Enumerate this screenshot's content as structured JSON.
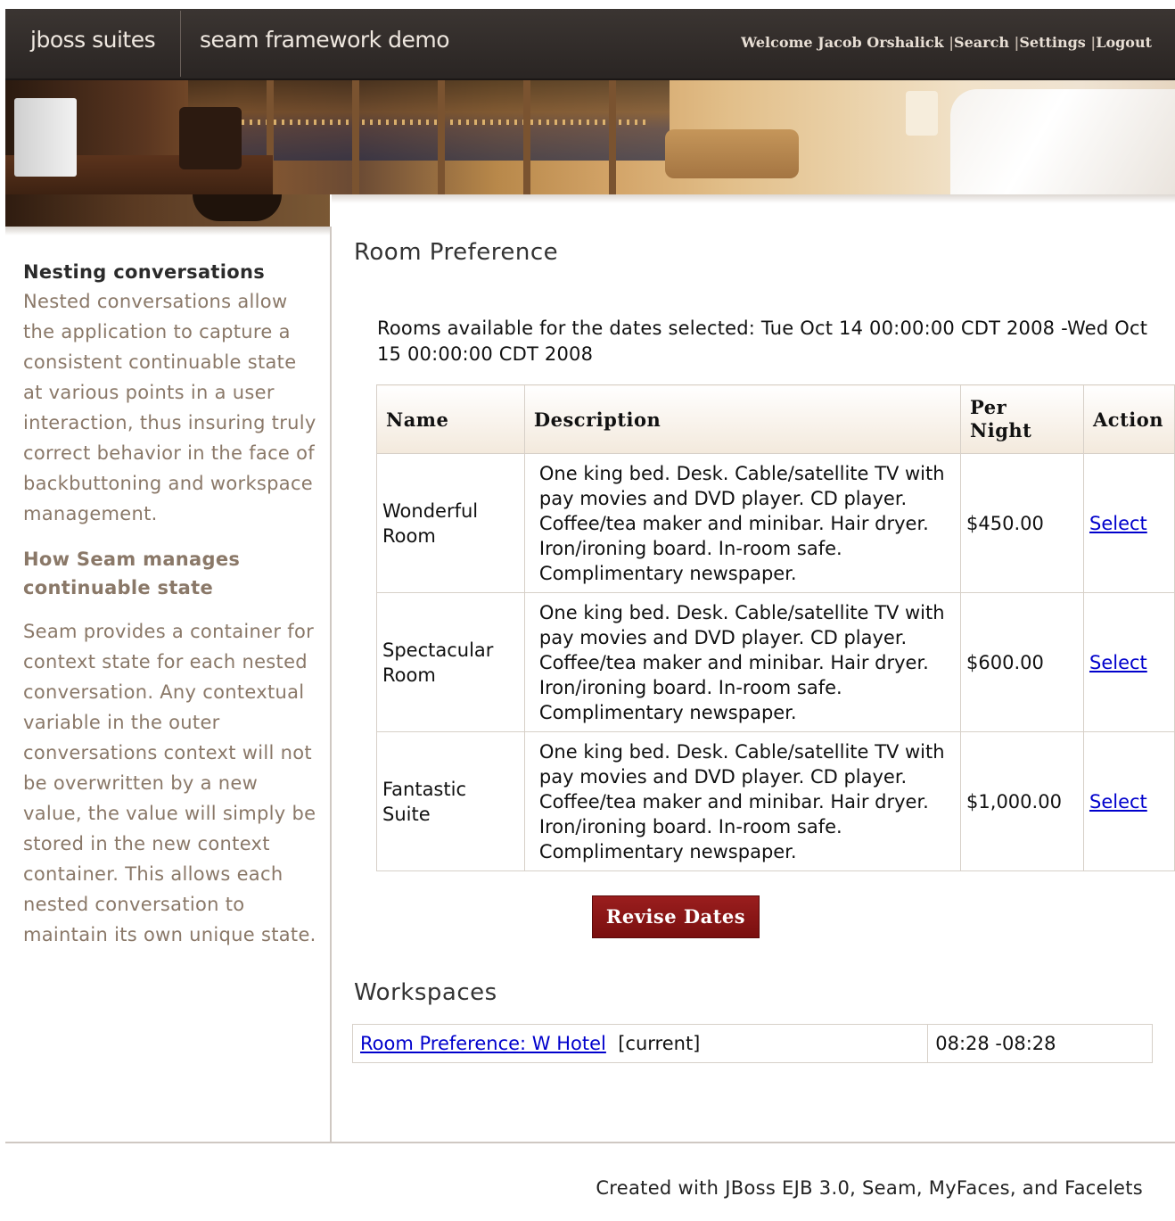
{
  "header": {
    "brand": "jboss suites",
    "app_title": "seam framework demo",
    "nav": {
      "welcome": "Welcome Jacob Orshalick",
      "search": "Search",
      "settings": "Settings",
      "logout": "Logout",
      "separator": "|"
    }
  },
  "sidebar": {
    "heading1": "Nesting conversations",
    "para1": "Nested conversations allow the application to capture a consistent continuable state at various points in a user interaction, thus insuring truly correct behavior in the face of backbuttoning and workspace management.",
    "heading2": "How Seam manages continuable state",
    "para2": "Seam provides a container for context state for each nested conversation. Any contextual variable in the outer conversations context will not be overwritten by a new value, the value will simply be stored in the new context container. This allows each nested conversation to maintain its own unique state."
  },
  "main": {
    "title": "Room Preference",
    "availability": "Rooms available for the dates selected: Tue Oct 14 00:00:00 CDT 2008 -Wed Oct 15 00:00:00 CDT 2008",
    "table": {
      "headers": [
        "Name",
        "Description",
        "Per Night",
        "Action"
      ],
      "rows": [
        {
          "name": "Wonderful Room",
          "description": "One king bed. Desk. Cable/satellite TV with pay movies and DVD player. CD player. Coffee/tea maker and minibar. Hair dryer. Iron/ironing board. In-room safe. Complimentary newspaper.",
          "price": "$450.00",
          "action": "Select"
        },
        {
          "name": "Spectacular Room",
          "description": "One king bed. Desk. Cable/satellite TV with pay movies and DVD player. CD player. Coffee/tea maker and minibar. Hair dryer. Iron/ironing board. In-room safe. Complimentary newspaper.",
          "price": "$600.00",
          "action": "Select"
        },
        {
          "name": "Fantastic Suite",
          "description": "One king bed. Desk. Cable/satellite TV with pay movies and DVD player. CD player. Coffee/tea maker and minibar. Hair dryer. Iron/ironing board. In-room safe. Complimentary newspaper.",
          "price": "$1,000.00",
          "action": "Select"
        }
      ]
    },
    "revise_button": "Revise Dates",
    "workspaces": {
      "title": "Workspaces",
      "items": [
        {
          "link": "Room Preference: W Hotel",
          "status": "[current]",
          "time": "08:28 -08:28"
        }
      ]
    }
  },
  "footer": {
    "text": "Created with JBoss EJB 3.0, Seam, MyFaces, and Facelets"
  }
}
